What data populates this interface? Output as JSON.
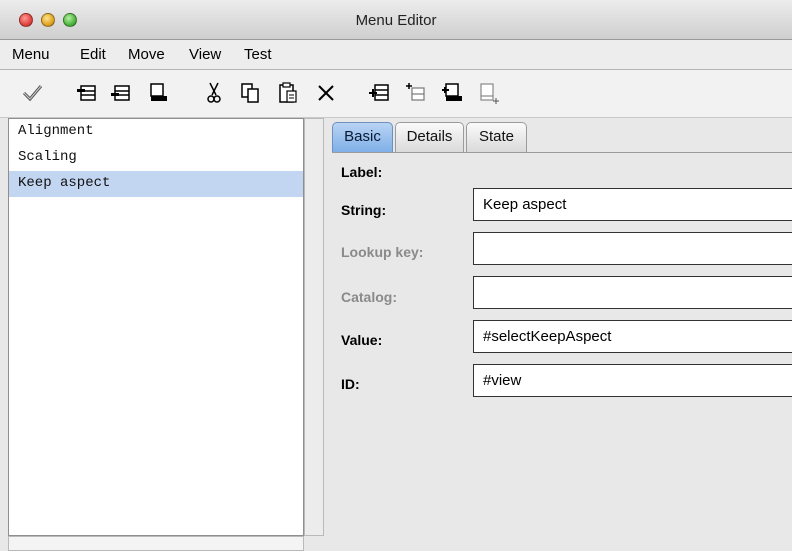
{
  "window": {
    "title": "Menu Editor"
  },
  "menubar": {
    "items": [
      {
        "label": "Menu"
      },
      {
        "label": "Edit"
      },
      {
        "label": "Move"
      },
      {
        "label": "View"
      },
      {
        "label": "Test"
      }
    ]
  },
  "toolbar": {
    "icons": [
      "check-icon",
      "insert-item-before-icon",
      "insert-item-icon",
      "insert-item-after-icon",
      "cut-icon",
      "copy-icon",
      "paste-icon",
      "delete-icon",
      "add-submenu-icon",
      "add-child-icon",
      "add-below-icon",
      "add-separator-icon"
    ]
  },
  "list": {
    "items": [
      {
        "label": "Alignment",
        "selected": false
      },
      {
        "label": "Scaling",
        "selected": false
      },
      {
        "label": "Keep aspect",
        "selected": true
      }
    ]
  },
  "tabs": [
    {
      "label": "Basic",
      "active": true
    },
    {
      "label": "Details",
      "active": false
    },
    {
      "label": "State",
      "active": false
    }
  ],
  "form": {
    "label_label": "Label:",
    "string_label": "String:",
    "string_value": "Keep aspect",
    "lookup_label": "Lookup key:",
    "lookup_value": "",
    "catalog_label": "Catalog:",
    "catalog_value": "",
    "value_label": "Value:",
    "value_value": "#selectKeepAspect",
    "id_label": "ID:",
    "id_value": "#view"
  },
  "colors": {
    "selection": "#c3d6f1",
    "active_tab": "#7fb0e8"
  }
}
